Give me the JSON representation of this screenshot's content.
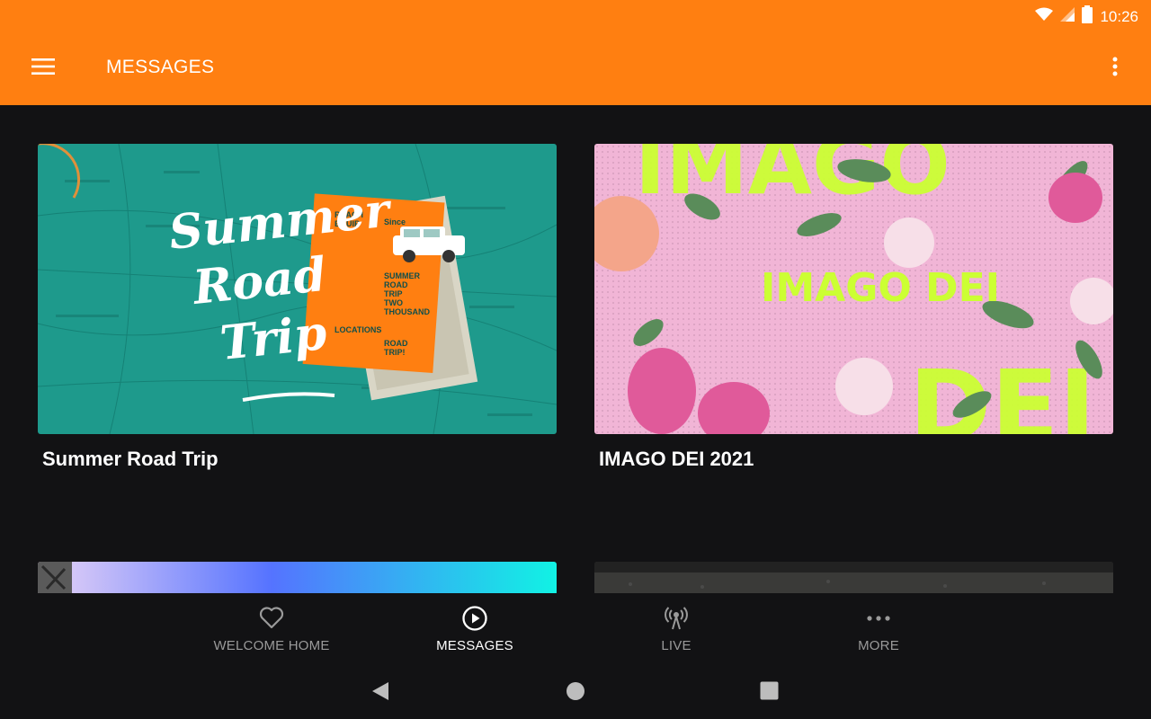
{
  "status": {
    "time": "10:26"
  },
  "appbar": {
    "title": "MESSAGES"
  },
  "cards": [
    {
      "title": "Summer Road Trip",
      "art_text": [
        "Summer",
        "Road",
        "Trip"
      ]
    },
    {
      "title": "IMAGO DEI 2021",
      "art_text": "IMAGO DEI"
    }
  ],
  "bottom_nav": [
    {
      "label": "WELCOME HOME",
      "icon": "heart-icon",
      "active": false
    },
    {
      "label": "MESSAGES",
      "icon": "play-circle-icon",
      "active": true
    },
    {
      "label": "LIVE",
      "icon": "broadcast-icon",
      "active": false
    },
    {
      "label": "MORE",
      "icon": "more-dots-icon",
      "active": false
    }
  ],
  "colors": {
    "accent": "#ff7f11",
    "background": "#121214",
    "teal": "#1e9a8c",
    "pink": "#f1b5d6",
    "lime": "#ccff33"
  }
}
